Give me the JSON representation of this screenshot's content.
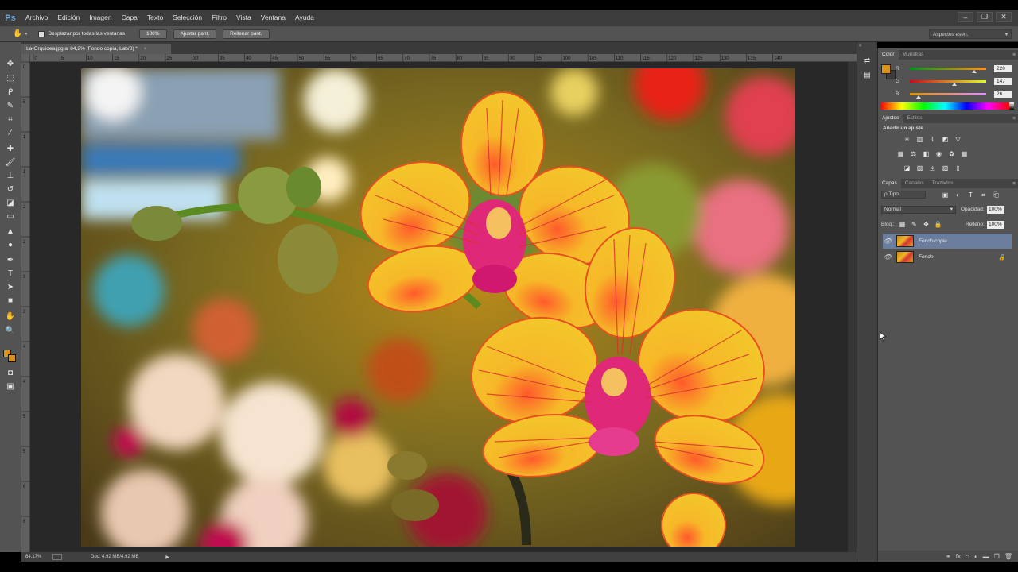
{
  "app": {
    "logo": "Ps"
  },
  "menu": [
    "Archivo",
    "Edición",
    "Imagen",
    "Capa",
    "Texto",
    "Selección",
    "Filtro",
    "Vista",
    "Ventana",
    "Ayuda"
  ],
  "window_controls": [
    "–",
    "❐",
    "✕"
  ],
  "options": {
    "scroll_all_label": "Desplazar por todas las ventanas",
    "zoom_100": "100%",
    "fit_screen": "Ajustar pant.",
    "fill_screen": "Rellenar pant.",
    "workspace": "Aspectos esen."
  },
  "document": {
    "tab_title": "La-Orquidea.jpg al 84,2% (Fondo copia, Lab/8) *",
    "zoom": "84,17%",
    "doc_info": "Doc: 4,92 MB/4,92 MB"
  },
  "ruler_h_ticks": [
    "0",
    "5",
    "10",
    "15",
    "20",
    "25",
    "30",
    "35",
    "40",
    "45",
    "50",
    "55",
    "60",
    "65",
    "70",
    "75",
    "80",
    "85",
    "90",
    "95",
    "100",
    "105",
    "110",
    "115",
    "120",
    "125",
    "130",
    "135",
    "140"
  ],
  "ruler_v_ticks": [
    "0",
    "5",
    "1",
    "1",
    "2",
    "2",
    "3",
    "3",
    "4",
    "4",
    "5",
    "5",
    "6",
    "6"
  ],
  "color_panel": {
    "tabs": [
      "Color",
      "Muestras"
    ],
    "foreground": "#dc931a",
    "background": "#3c3c3c",
    "r": {
      "label": "R",
      "value": "220"
    },
    "g": {
      "label": "G",
      "value": "147"
    },
    "b": {
      "label": "B",
      "value": "26"
    }
  },
  "adjustments_panel": {
    "tabs": [
      "Ajustes",
      "Estilos"
    ],
    "title": "Añadir un ajuste"
  },
  "layers_panel": {
    "tabs": [
      "Capas",
      "Canales",
      "Trazados"
    ],
    "filter": "ρ Tipo",
    "blend_mode": "Normal",
    "opacity_label": "Opacidad:",
    "opacity_value": "100%",
    "lock_label": "Bloq.:",
    "fill_label": "Relleno:",
    "fill_value": "100%",
    "layers": [
      {
        "name": "Fondo copia",
        "selected": true
      },
      {
        "name": "Fondo",
        "selected": false
      }
    ]
  },
  "accent_color": "#6a7d9c"
}
